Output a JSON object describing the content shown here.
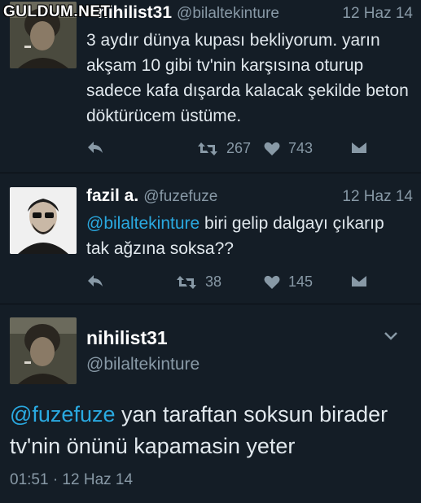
{
  "watermark": "GULDUM.NET",
  "tweets": [
    {
      "name": "nihilist31",
      "handle": "@bilaltekinture",
      "date": "12 Haz 14",
      "text": "3 aydır dünya kupası bekliyorum. yarın akşam 10 gibi tv'nin karşısına oturup sadece kafa dışarda kalacak şekilde beton döktürücem üstüme.",
      "retweets": "267",
      "likes": "743"
    },
    {
      "name": "fazil a.",
      "handle": "@fuzefuze",
      "date": "12 Haz 14",
      "mention": "@bilaltekinture",
      "text": " biri gelip dalgayı çıkarıp tak ağzına soksa??",
      "retweets": "38",
      "likes": "145"
    }
  ],
  "main_tweet": {
    "name": "nihilist31",
    "handle": "@bilaltekinture",
    "mention": "@fuzefuze",
    "text": " yan taraftan soksun birader tv'nin önünü kapamasin yeter",
    "timestamp": "01:51 · 12 Haz 14"
  },
  "icons": {
    "reply": "reply-icon",
    "retweet": "retweet-icon",
    "like": "heart-icon",
    "dm": "direct-message-icon",
    "more": "chevron-down-icon"
  },
  "colors": {
    "background": "#141d26",
    "text": "#e1e8ed",
    "muted": "#8899a6",
    "mention": "#2aa9e0"
  }
}
